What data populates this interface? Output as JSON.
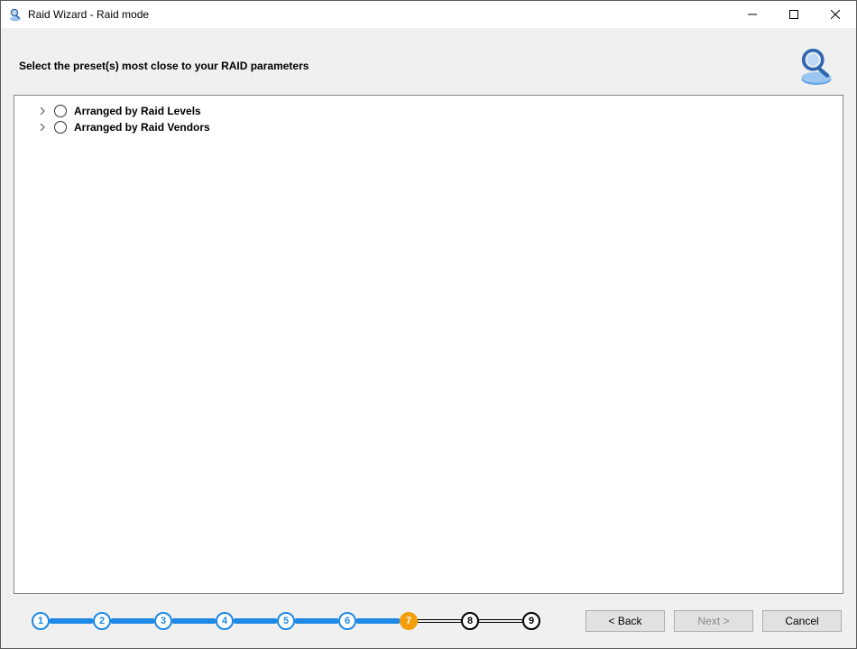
{
  "window": {
    "title": "Raid Wizard - Raid mode"
  },
  "header": {
    "instruction": "Select the preset(s) most close to your RAID parameters"
  },
  "tree": {
    "items": [
      {
        "label": "Arranged by Raid Levels"
      },
      {
        "label": "Arranged by Raid Vendors"
      }
    ]
  },
  "steps": {
    "count": 9,
    "current": 7,
    "labels": [
      "1",
      "2",
      "3",
      "4",
      "5",
      "6",
      "7",
      "8",
      "9"
    ]
  },
  "buttons": {
    "back": "< Back",
    "next": "Next >",
    "cancel": "Cancel"
  },
  "colors": {
    "accent": "#1e88e5",
    "current": "#f59e0b"
  }
}
